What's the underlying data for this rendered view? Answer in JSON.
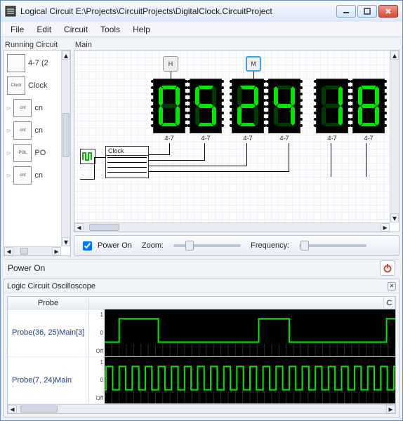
{
  "title": "Logical Circuit E:\\Projects\\CircuitProjects\\DigitalClock.CircuitProject",
  "menu": {
    "file": "File",
    "edit": "Edit",
    "circuit": "Circuit",
    "tools": "Tools",
    "help": "Help"
  },
  "left": {
    "header": "Running Circuit",
    "items": [
      {
        "label": "4-7 (2",
        "icon": ""
      },
      {
        "label": "Clock",
        "icon": "Clock"
      },
      {
        "label": "cn",
        "icon": "cnt"
      },
      {
        "label": "cn",
        "icon": "cnt"
      },
      {
        "label": "PO",
        "icon": "POL"
      },
      {
        "label": "cn",
        "icon": "cnt"
      }
    ]
  },
  "main": {
    "header": "Main",
    "h_label": "H",
    "m_label": "M",
    "clock_label": "Clock",
    "seg_label": "4-7",
    "digits": [
      "0",
      "5",
      "2",
      "4",
      "1",
      "8"
    ]
  },
  "toolbar": {
    "power_on_label": "Power On",
    "power_on_checked": true,
    "zoom_label": "Zoom:",
    "frequency_label": "Frequency:"
  },
  "status": {
    "text": "Power On"
  },
  "osc": {
    "title": "Logic Circuit Oscilloscope",
    "col_probe": "Probe",
    "col_c": "C",
    "probes": [
      {
        "name": "Probe(36, 25)Main[3]",
        "labels": [
          "1",
          "0",
          "Off"
        ]
      },
      {
        "name": "Probe(7, 24)Main",
        "labels": [
          "1",
          "0",
          "Off"
        ]
      }
    ]
  },
  "seg_map": {
    "0": [
      "a",
      "b",
      "c",
      "d",
      "e",
      "f"
    ],
    "1": [
      "b",
      "c"
    ],
    "2": [
      "a",
      "b",
      "g",
      "e",
      "d"
    ],
    "3": [
      "a",
      "b",
      "g",
      "c",
      "d"
    ],
    "4": [
      "f",
      "g",
      "b",
      "c"
    ],
    "5": [
      "a",
      "f",
      "g",
      "c",
      "d"
    ],
    "6": [
      "a",
      "f",
      "g",
      "e",
      "c",
      "d"
    ],
    "7": [
      "a",
      "b",
      "c"
    ],
    "8": [
      "a",
      "b",
      "c",
      "d",
      "e",
      "f",
      "g"
    ],
    "9": [
      "a",
      "b",
      "c",
      "d",
      "f",
      "g"
    ]
  }
}
